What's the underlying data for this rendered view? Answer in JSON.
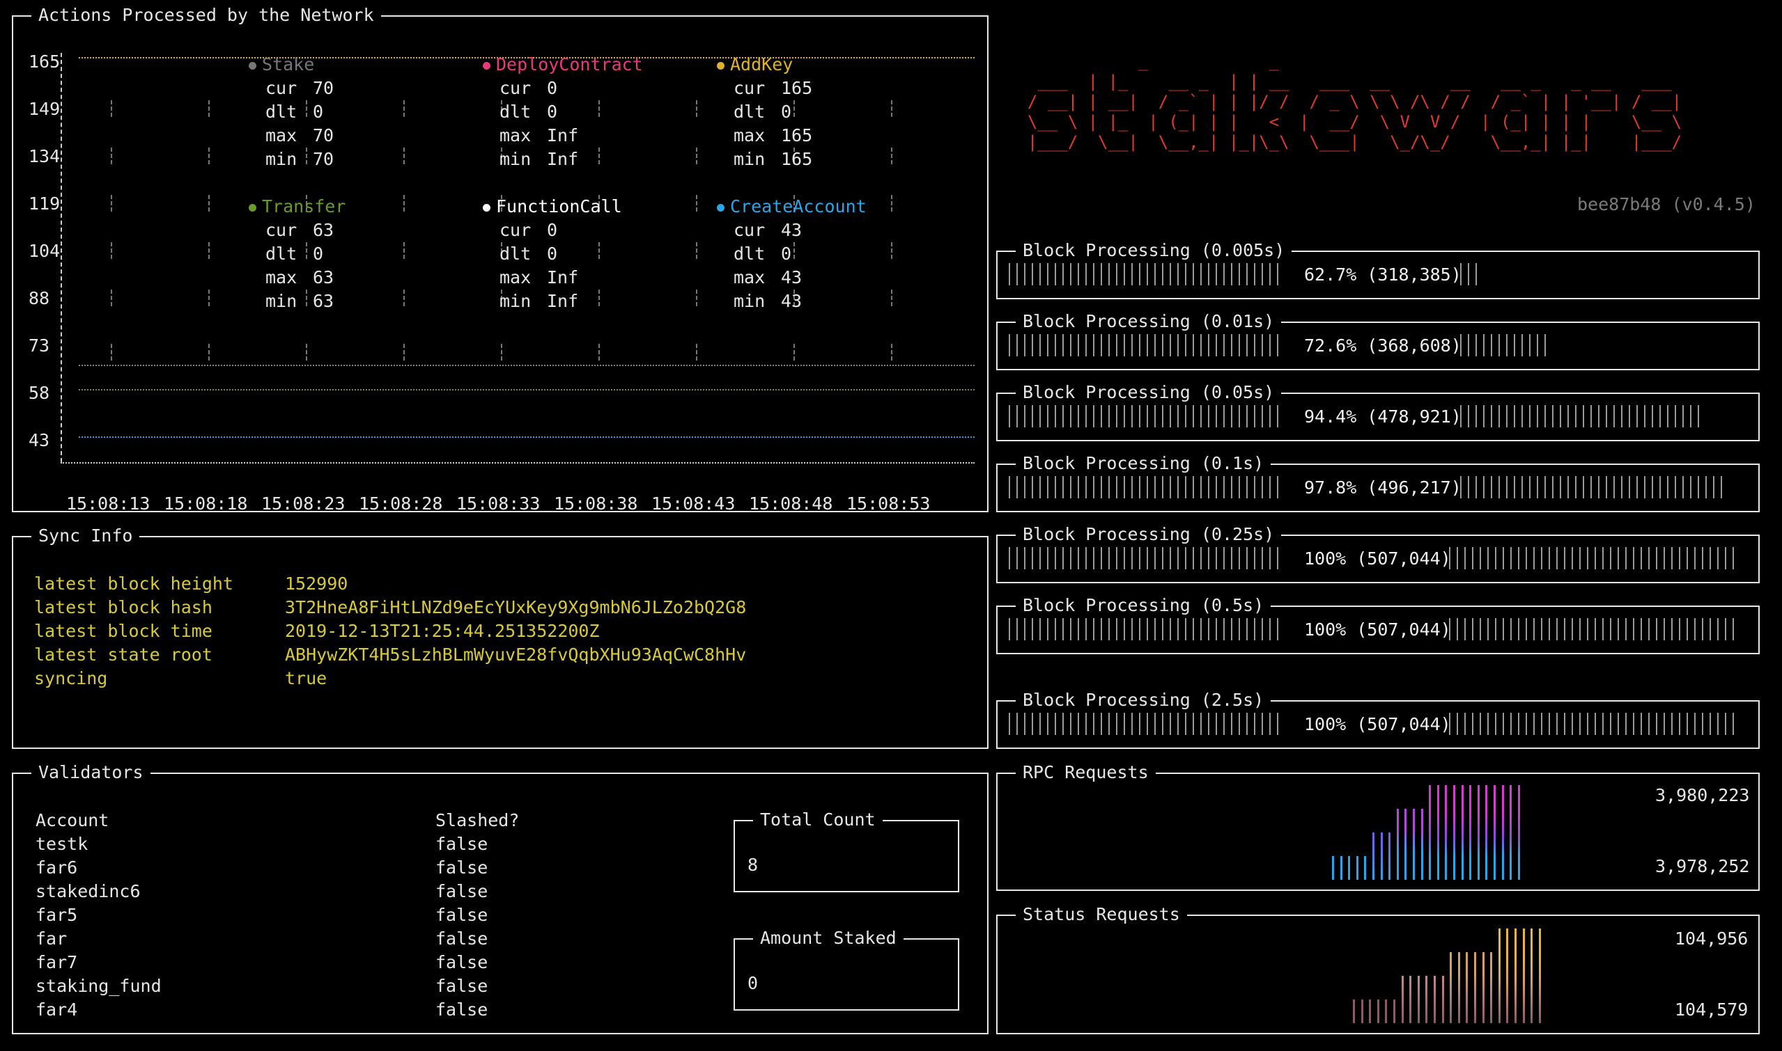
{
  "actions_panel": {
    "title": "Actions Processed by the Network",
    "y_labels": [
      "165",
      "149",
      "134",
      "119",
      "104",
      "88",
      "73",
      "58",
      "43"
    ],
    "x_labels": [
      "15:08:13",
      "15:08:18",
      "15:08:23",
      "15:08:28",
      "15:08:33",
      "15:08:38",
      "15:08:43",
      "15:08:48",
      "15:08:53"
    ],
    "legend": [
      {
        "name": "Stake",
        "color": "#777777",
        "cur": "70",
        "dlt": "0",
        "max": "70",
        "min": "70"
      },
      {
        "name": "DeployContract",
        "color": "#e8397a",
        "cur": "0",
        "dlt": "0",
        "max": "Inf",
        "min": "Inf"
      },
      {
        "name": "AddKey",
        "color": "#e0b22a",
        "cur": "165",
        "dlt": "0",
        "max": "165",
        "min": "165"
      },
      {
        "name": "Transfer",
        "color": "#6a9a2a",
        "cur": "63",
        "dlt": "0",
        "max": "63",
        "min": "63"
      },
      {
        "name": "FunctionCall",
        "color": "#ffffff",
        "cur": "0",
        "dlt": "0",
        "max": "Inf",
        "min": "Inf"
      },
      {
        "name": "CreateAccount",
        "color": "#2aa6e8",
        "cur": "43",
        "dlt": "0",
        "max": "43",
        "min": "43"
      }
    ],
    "stat_labels": {
      "cur": "cur",
      "dlt": "dlt",
      "max": "max",
      "min": "min"
    }
  },
  "logo": {
    "ascii": [
      "             _            _                                          ",
      "   ___  | |_    __ _  | | __   ___  __      __   __ _   _ __   ___ ",
      "  / __| | __|  / _` | | |/ /  / _ \\ \\ \\ /\\ / /  / _` | | '__| / __|",
      "  \\__ \\ | |_  | (_| | |   <  |  __/  \\ V  V /  | (_| | | |    \\__ \\",
      "  |___/  \\__|  \\__,_| |_|\\_\\  \\___|   \\_/\\_/    \\__,_| |_|    |___/"
    ],
    "version": "bee87b48 (v0.4.5)"
  },
  "block_processing": [
    {
      "title": "Block Processing (0.005s)",
      "label": "62.7% (318,385)",
      "fraction": 0.627
    },
    {
      "title": "Block Processing (0.01s)",
      "label": "72.6% (368,608)",
      "fraction": 0.726
    },
    {
      "title": "Block Processing (0.05s)",
      "label": "94.4% (478,921)",
      "fraction": 0.944
    },
    {
      "title": "Block Processing (0.1s)",
      "label": "97.8% (496,217)",
      "fraction": 0.978
    },
    {
      "title": "Block Processing (0.25s)",
      "label": "100% (507,044)",
      "fraction": 1.0
    },
    {
      "title": "Block Processing (0.5s)",
      "label": "100% (507,044)",
      "fraction": 1.0
    },
    {
      "title": "Block Processing (2.5s)",
      "label": "100% (507,044)",
      "fraction": 1.0
    }
  ],
  "sync_info": {
    "title": "Sync Info",
    "rows": [
      {
        "label": "latest block height",
        "value": "152990"
      },
      {
        "label": "latest block hash",
        "value": "3T2HneA8FiHtLNZd9eEcYUxKey9Xg9mbN6JLZo2bQ2G8"
      },
      {
        "label": "latest block time",
        "value": "2019-12-13T21:25:44.251352200Z"
      },
      {
        "label": "latest state root",
        "value": "ABHywZKT4H5sLzhBLmWyuvE28fvQqbXHu93AqCwC8hHv"
      },
      {
        "label": "syncing",
        "value": "true"
      }
    ]
  },
  "validators": {
    "title": "Validators",
    "col_account": "Account",
    "col_slashed": "Slashed?",
    "rows": [
      {
        "account": "testk",
        "slashed": "false"
      },
      {
        "account": "far6",
        "slashed": "false"
      },
      {
        "account": "stakedinc6",
        "slashed": "false"
      },
      {
        "account": "far5",
        "slashed": "false"
      },
      {
        "account": "far",
        "slashed": "false"
      },
      {
        "account": "far7",
        "slashed": "false"
      },
      {
        "account": "staking_fund",
        "slashed": "false"
      },
      {
        "account": "far4",
        "slashed": "false"
      }
    ],
    "total_count_title": "Total Count",
    "total_count": "8",
    "amount_staked_title": "Amount Staked",
    "amount_staked": "0"
  },
  "rpc_requests": {
    "title": "RPC Requests",
    "max_label": "3,980,223",
    "min_label": "3,978,252"
  },
  "status_requests": {
    "title": "Status Requests",
    "max_label": "104,956",
    "min_label": "104,579"
  }
}
